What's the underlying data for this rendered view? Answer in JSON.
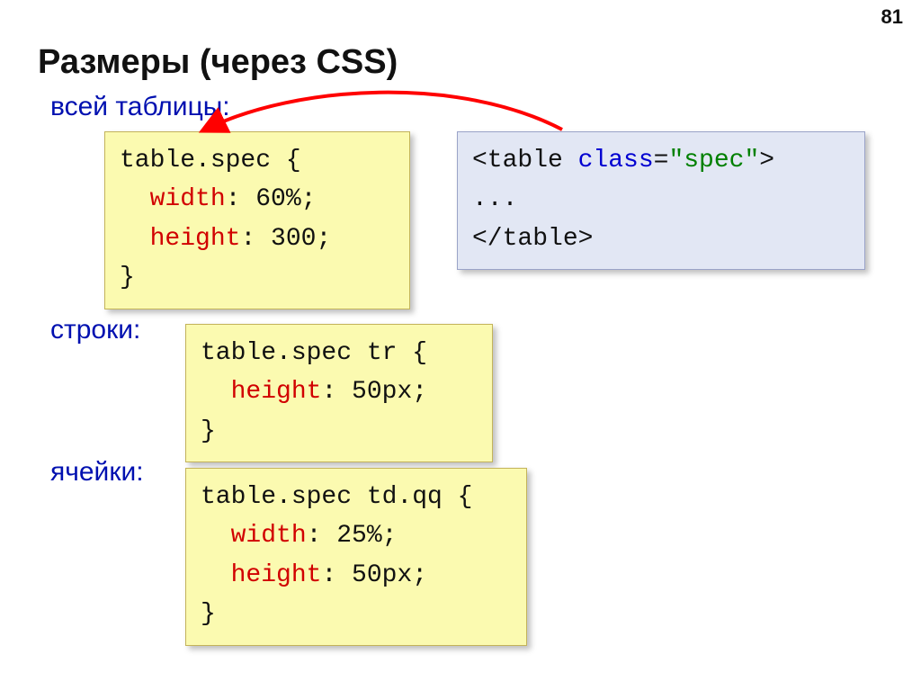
{
  "pageNumber": "81",
  "title": "Размеры (через CSS)",
  "labels": {
    "table": "всей таблицы:",
    "row": "строки:",
    "cell": "ячейки:"
  },
  "code": {
    "box1": {
      "l1_selector": "table.spec {",
      "l2_prop": "width",
      "l2_rest": ": 60%;",
      "l3_prop": "height",
      "l3_rest": ": 300;",
      "l4": "}"
    },
    "box2": {
      "l1_open": "<table ",
      "l1_attr": "class",
      "l1_eq": "=",
      "l1_val": "\"spec\"",
      "l1_close": ">",
      "l2": "...",
      "l3": "</table>"
    },
    "box3": {
      "l1_selector": "table.spec tr {",
      "l2_prop": "height",
      "l2_rest": ": 50px;",
      "l3": "}"
    },
    "box4": {
      "l1_selector": "table.spec td.qq {",
      "l2_prop": "width",
      "l2_rest": ": 25%;",
      "l3_prop": "height",
      "l3_rest": ": 50px;",
      "l4": "}"
    }
  }
}
